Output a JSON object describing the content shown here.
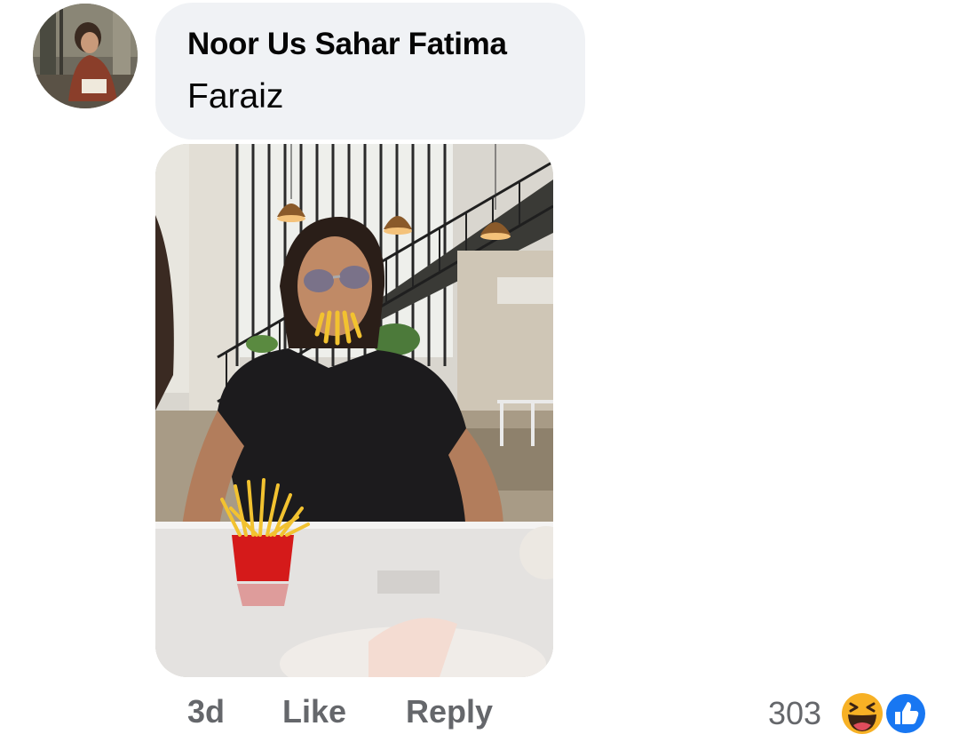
{
  "comment": {
    "author": "Noor Us Sahar Fatima",
    "text": "Faraiz",
    "avatar_icon": "profile-photo",
    "attachment_icon": "photo-attachment"
  },
  "actions": {
    "time": "3d",
    "like_label": "Like",
    "reply_label": "Reply"
  },
  "reactions": {
    "count": "303",
    "types": [
      "haha-emoji-icon",
      "like-thumb-icon"
    ],
    "like_color": "#1877f2",
    "haha_color": "#f7b125"
  },
  "colors": {
    "bubble": "#f0f2f5",
    "text": "#050505",
    "secondary": "#65676b"
  }
}
